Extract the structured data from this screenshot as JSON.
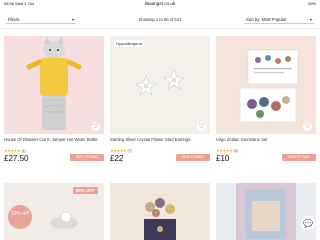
{
  "status": {
    "time": "08:56  Wed 1 Oct",
    "url": "lisaangel.co.uk",
    "battery": "49%"
  },
  "toolbar": {
    "filters_label": "Filters",
    "showing_text": "Showing 1 to 60 of 521",
    "sort_label": "Sort by: Most Popular"
  },
  "products": [
    {
      "name": "House Of Disaster Cat In Jumper Hot Water Bottle",
      "stars": "★★★★★",
      "reviews": "(1)",
      "price": "£27.50",
      "add_label": "ADD TO BAG",
      "tag": ""
    },
    {
      "name": "Sterling Silver Crystal Flower Stud Earrings",
      "stars": "★★★★★",
      "reviews": "(7)",
      "price": "£22",
      "add_label": "ADD TO BAG",
      "tag": "Hypoallergenic"
    },
    {
      "name": "Virgo Zodiac Gemstone Set",
      "stars": "★★★★★",
      "reviews": "(3)",
      "price": "£10",
      "add_label": "ADD TO BAG",
      "tag": ""
    }
  ],
  "row2": {
    "sale_badge": "50% OFF",
    "promo_badge": "10% off!"
  },
  "colors": {
    "accent": "#e8a395",
    "star": "#f0b400"
  },
  "icons": {
    "wishlist": "heart-outline-icon",
    "chat": "chat-icon",
    "chevron": "chevron-down-icon"
  }
}
